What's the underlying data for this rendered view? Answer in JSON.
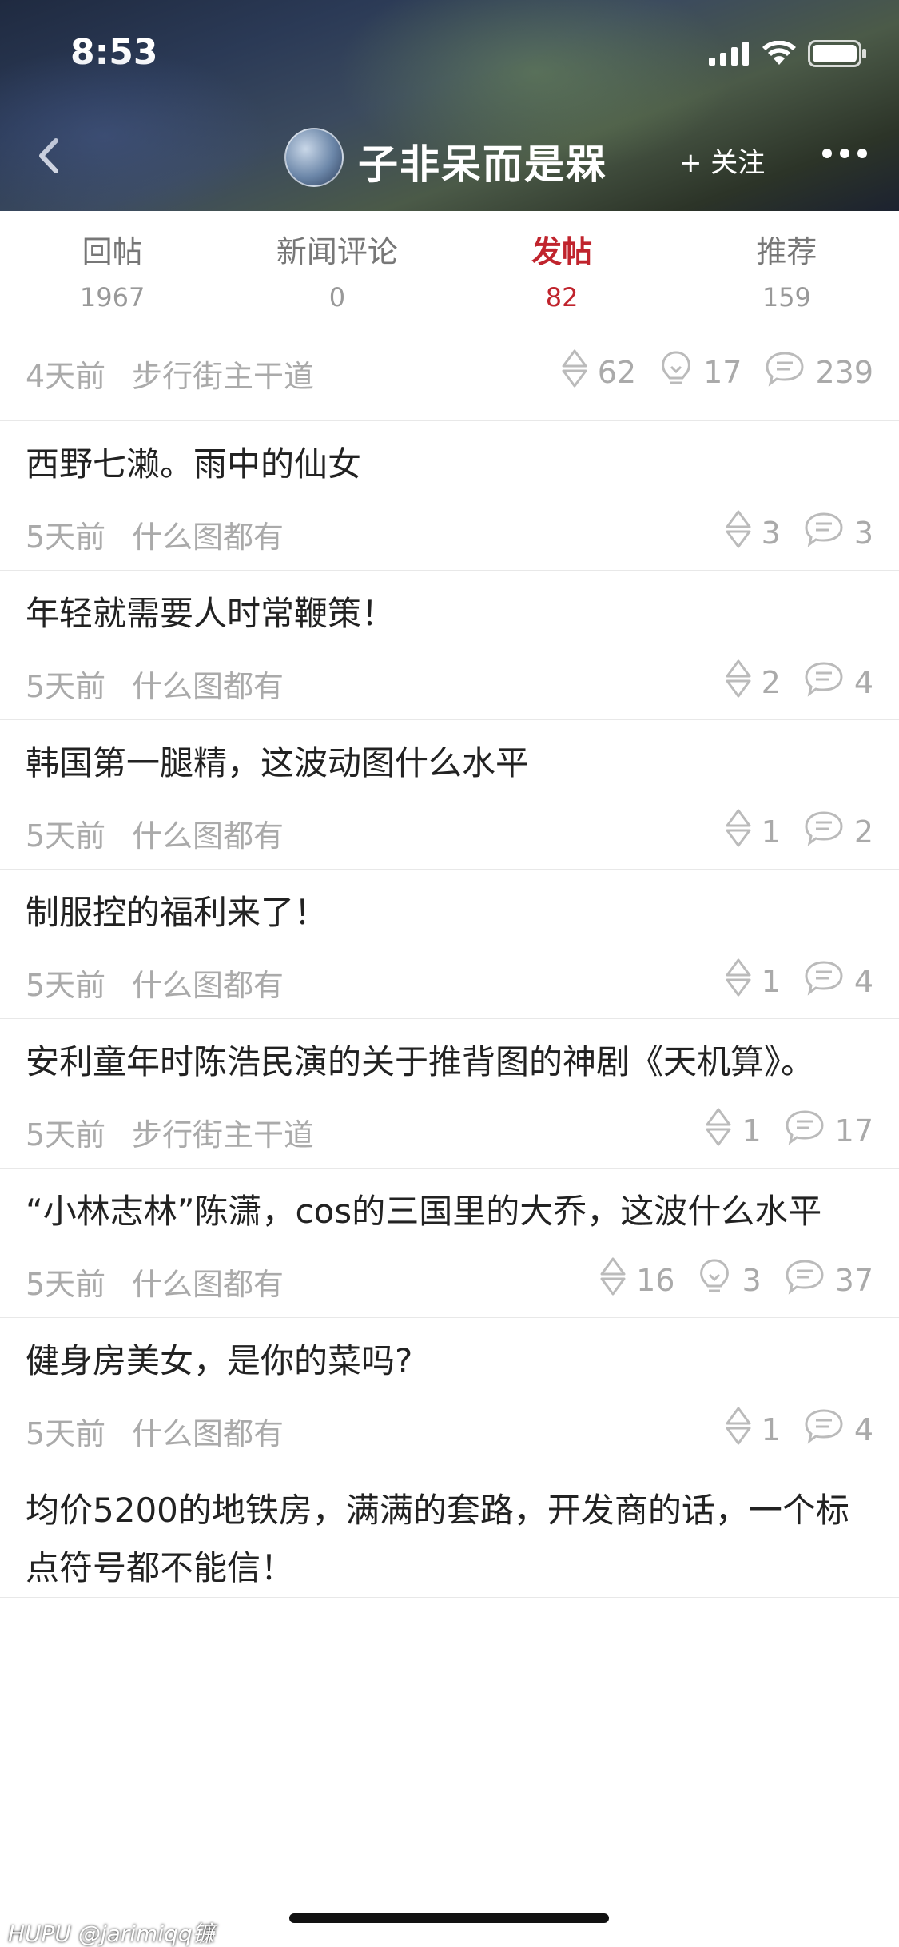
{
  "status_bar": {
    "time": "8:53"
  },
  "header": {
    "user_name": "子非呆而是槑",
    "follow_label": "+ 关注"
  },
  "tabs": [
    {
      "label": "回帖",
      "count": "1967"
    },
    {
      "label": "新闻评论",
      "count": "0"
    },
    {
      "label": "发帖",
      "count": "82"
    },
    {
      "label": "推荐",
      "count": "159"
    }
  ],
  "active_tab": "发帖",
  "posts": [
    {
      "title": "",
      "time": "4天前",
      "board": "步行街主干道",
      "votes": "62",
      "lights": "17",
      "replies": "239"
    },
    {
      "title": "西野七濑。雨中的仙女",
      "time": "5天前",
      "board": "什么图都有",
      "votes": "3",
      "lights": "",
      "replies": "3"
    },
    {
      "title": "年轻就需要人时常鞭策！",
      "time": "5天前",
      "board": "什么图都有",
      "votes": "2",
      "lights": "",
      "replies": "4"
    },
    {
      "title": "韩国第一腿精，这波动图什么水平",
      "time": "5天前",
      "board": "什么图都有",
      "votes": "1",
      "lights": "",
      "replies": "2"
    },
    {
      "title": "制服控的福利来了！",
      "time": "5天前",
      "board": "什么图都有",
      "votes": "1",
      "lights": "",
      "replies": "4"
    },
    {
      "title": "安利童年时陈浩民演的关于推背图的神剧《天机算》。",
      "time": "5天前",
      "board": "步行街主干道",
      "votes": "1",
      "lights": "",
      "replies": "17"
    },
    {
      "title": "“小林志林”陈潇，cos的三国里的大乔，这波什么水平",
      "time": "5天前",
      "board": "什么图都有",
      "votes": "16",
      "lights": "3",
      "replies": "37"
    },
    {
      "title": "健身房美女，是你的菜吗?",
      "time": "5天前",
      "board": "什么图都有",
      "votes": "1",
      "lights": "",
      "replies": "4"
    },
    {
      "title": "均价5200的地铁房，满满的套路，开发商的话，一个标点符号都不能信！",
      "time": "",
      "board": "",
      "votes": "",
      "lights": "",
      "replies": ""
    }
  ],
  "watermark": "HUPU @jarimiqq镰",
  "colors": {
    "accent": "#c0242d",
    "muted": "#aaaaaa",
    "text": "#222222"
  }
}
